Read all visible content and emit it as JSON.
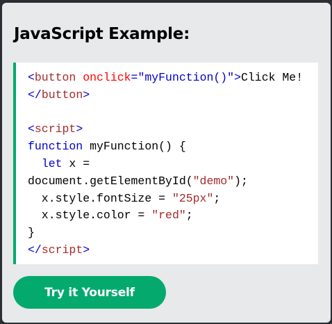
{
  "heading": "JavaScript Example:",
  "code": {
    "l1_open": "<",
    "l1_tag": "button",
    "l1_attr": " onclick",
    "l1_eq": "=",
    "l1_val": "\"myFunction()\"",
    "l1_close": ">",
    "l1_text": "Click Me!",
    "l2_open": "</",
    "l2_tag": "button",
    "l2_close": ">",
    "l4_open": "<",
    "l4_tag": "script",
    "l4_close": ">",
    "l5_kw": "function",
    "l5_rest": " myFunction() {",
    "l6_indent": "  ",
    "l6_kw": "let",
    "l6_rest": " x =",
    "l7_a": "document.getElementById(",
    "l7_str": "\"demo\"",
    "l7_b": ");",
    "l8_a": "  x.style.fontSize = ",
    "l8_str": "\"25px\"",
    "l8_b": ";",
    "l9_a": "  x.style.color = ",
    "l9_str": "\"red\"",
    "l9_b": ";",
    "l10": "}",
    "l11_open": "</",
    "l11_tag": "script",
    "l11_close": ">"
  },
  "button": {
    "label": "Try it Yourself"
  },
  "colors": {
    "accent": "#04aa6d",
    "tag": "#0000cd",
    "tagname": "#a52a2a",
    "attr": "#ff0000",
    "card_bg": "#e7e9eb",
    "page_bg": "#2b2f33"
  }
}
